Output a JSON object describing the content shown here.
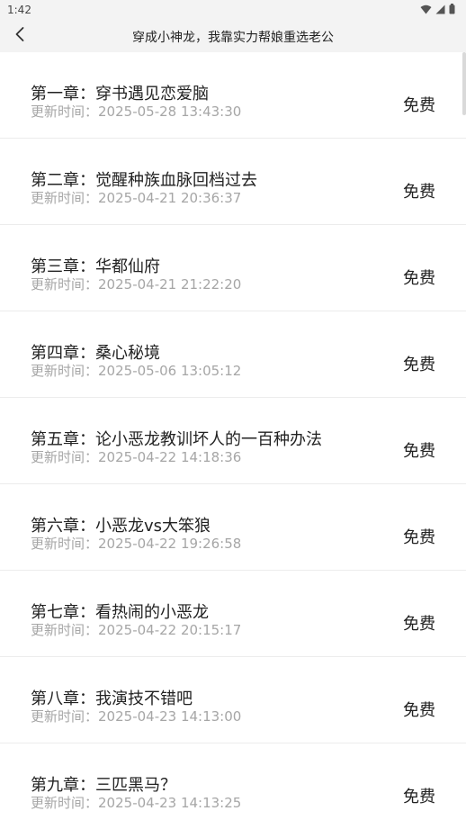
{
  "status": {
    "time": "1:42"
  },
  "header": {
    "title": "穿成小神龙，我靠实力帮娘重选老公"
  },
  "chapters": [
    {
      "title": "第一章：穿书遇见恋爱脑",
      "time_prefix": "更新时间：",
      "time": "2025-05-28 13:43:30",
      "price": "免费"
    },
    {
      "title": "第二章：觉醒种族血脉回档过去",
      "time_prefix": "更新时间：",
      "time": "2025-04-21 20:36:37",
      "price": "免费"
    },
    {
      "title": "第三章：华都仙府",
      "time_prefix": "更新时间：",
      "time": "2025-04-21 21:22:20",
      "price": "免费"
    },
    {
      "title": "第四章：桑心秘境",
      "time_prefix": "更新时间：",
      "time": "2025-05-06 13:05:12",
      "price": "免费"
    },
    {
      "title": "第五章：论小恶龙教训坏人的一百种办法",
      "time_prefix": "更新时间：",
      "time": "2025-04-22 14:18:36",
      "price": "免费"
    },
    {
      "title": "第六章：小恶龙vs大笨狼",
      "time_prefix": "更新时间：",
      "time": "2025-04-22 19:26:58",
      "price": "免费"
    },
    {
      "title": "第七章：看热闹的小恶龙",
      "time_prefix": "更新时间：",
      "time": "2025-04-22 20:15:17",
      "price": "免费"
    },
    {
      "title": "第八章：我演技不错吧",
      "time_prefix": "更新时间：",
      "time": "2025-04-23 14:13:00",
      "price": "免费"
    },
    {
      "title": "第九章：三匹黑马？",
      "time_prefix": "更新时间：",
      "time": "2025-04-23 14:13:25",
      "price": "免费"
    }
  ],
  "icons": {
    "back": "chevron-left-icon",
    "wifi": "wifi-icon",
    "signal": "signal-icon",
    "battery": "battery-icon"
  }
}
